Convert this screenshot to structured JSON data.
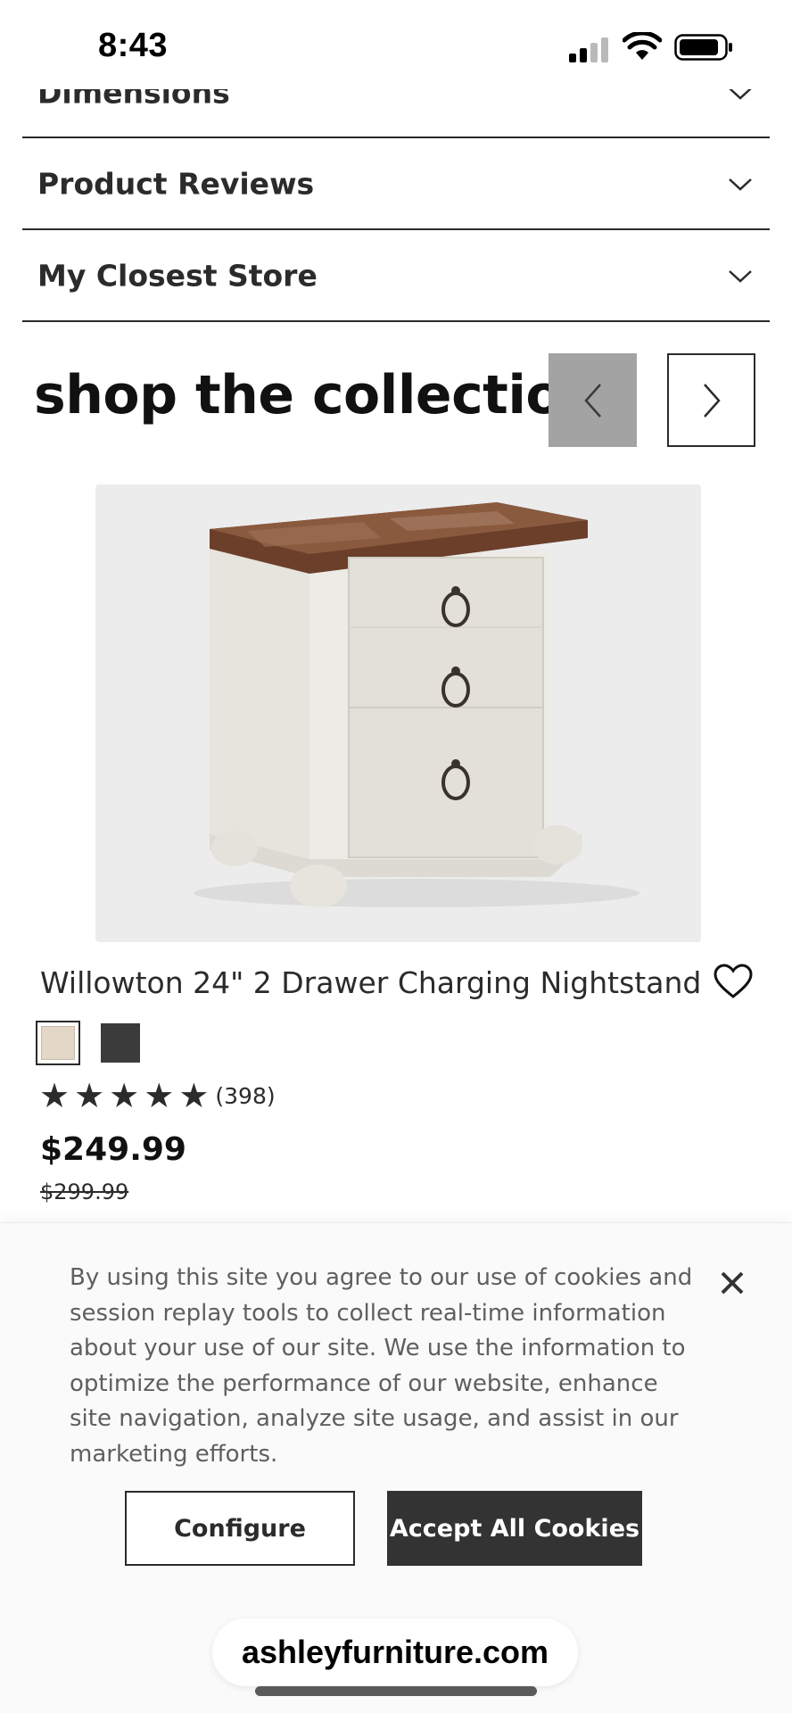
{
  "status_bar": {
    "time": "8:43"
  },
  "accordion": [
    {
      "title": "Dimensions"
    },
    {
      "title": "Product Reviews"
    },
    {
      "title": "My Closest Store"
    }
  ],
  "collection": {
    "title": "shop the collection"
  },
  "product": {
    "name": "Willowton 24\" 2 Drawer Charging Nightstand",
    "rating": 5,
    "rating_count": "(398)",
    "price": "$249.99",
    "old_price": "$299.99",
    "swatches": [
      {
        "color": "#e3d8c8",
        "selected": true
      },
      {
        "color": "#3b3b3b",
        "selected": false
      }
    ]
  },
  "cookie_banner": {
    "text": "By using this site you agree to our use of cookies and session replay tools to collect real-time information about your use of our site. We use the information to optimize the performance of our website, enhance site navigation, analyze site usage, and assist in our marketing efforts.",
    "configure_label": "Configure",
    "accept_label": "Accept All Cookies"
  },
  "browser": {
    "url": "ashleyfurniture.com"
  },
  "colors": {
    "text_dark": "#2b2b2b",
    "prev_button": "#a3a3a3",
    "accept_button": "#333333"
  }
}
